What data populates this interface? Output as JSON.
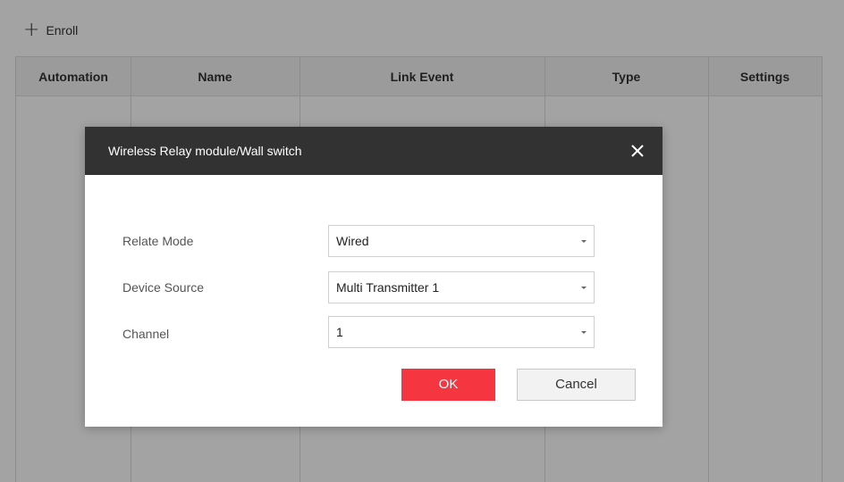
{
  "toolbar": {
    "enroll_icon": "plus-icon",
    "enroll_label": "Enroll"
  },
  "table": {
    "columns": [
      "Automation",
      "Name",
      "Link Event",
      "Type",
      "Settings"
    ],
    "rows": []
  },
  "dialog": {
    "title": "Wireless Relay module/Wall switch",
    "close_icon": "close-icon",
    "fields": [
      {
        "label": "Relate Mode",
        "value": "Wired"
      },
      {
        "label": "Device Source",
        "value": "Multi Transmitter 1"
      },
      {
        "label": "Channel",
        "value": "1"
      }
    ],
    "ok_label": "OK",
    "cancel_label": "Cancel"
  },
  "colors": {
    "accent": "#f5353f",
    "dialog_header": "#323232",
    "table_header_bg": "#f3f3f3"
  }
}
